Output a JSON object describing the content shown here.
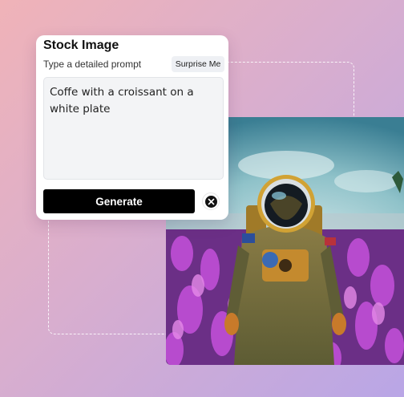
{
  "card": {
    "title": "Stock Image",
    "prompt_label": "Type a detailed prompt",
    "surprise_label": "Surprise Me",
    "prompt_value": "Coffe with a croissant on a white plate",
    "generate_label": "Generate"
  },
  "icons": {
    "clear": "close-circle-icon"
  },
  "colors": {
    "generate_bg": "#000000",
    "prompt_bg": "#f3f4f6",
    "page_gradient_start": "#f0b3b8",
    "page_gradient_end": "#b9a6e6"
  }
}
